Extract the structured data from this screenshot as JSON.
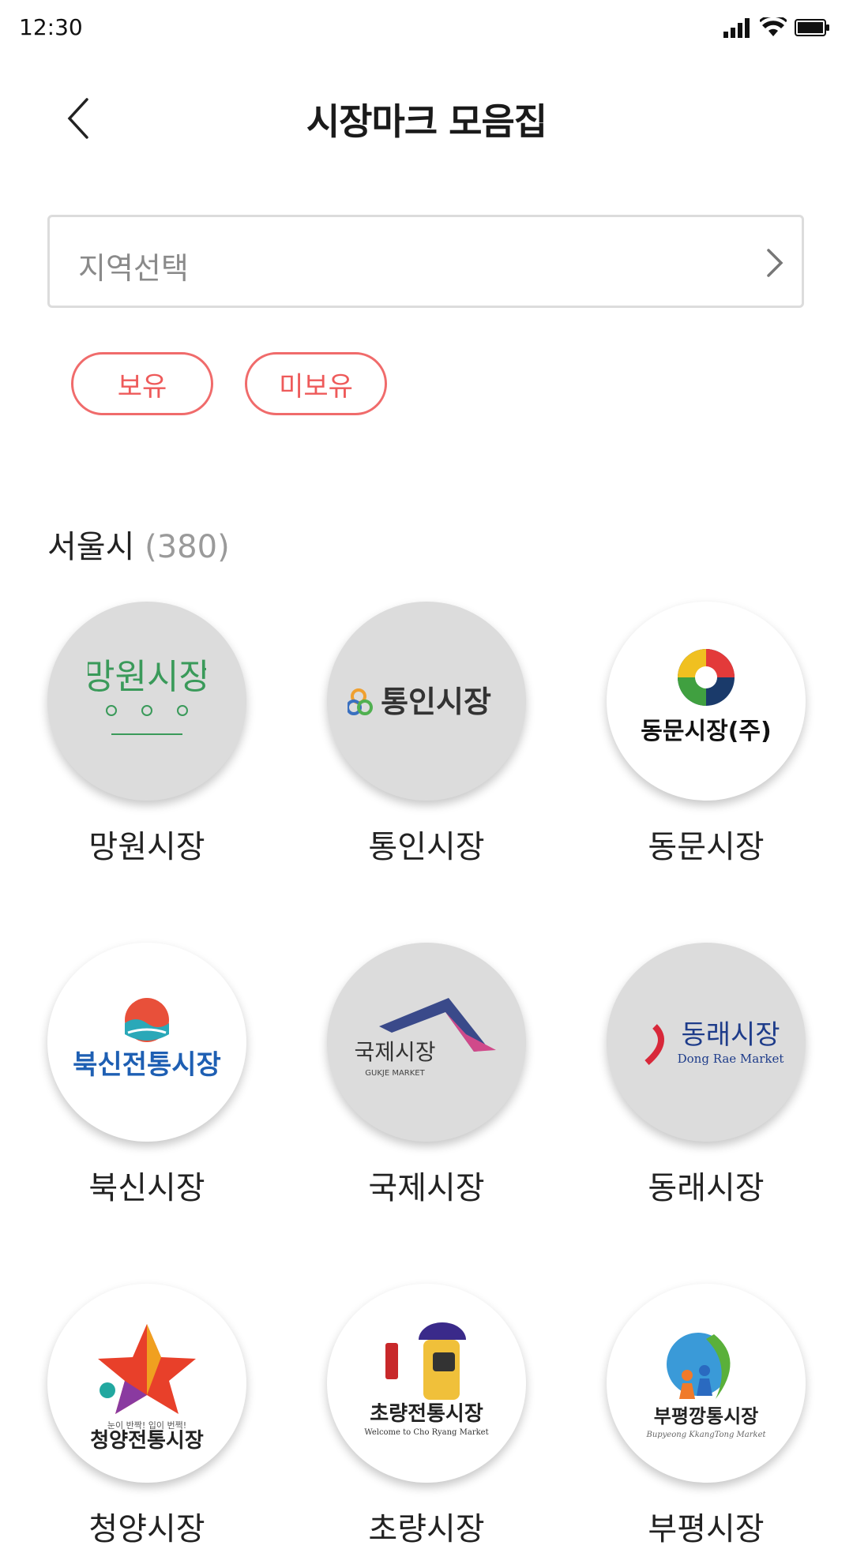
{
  "status_bar": {
    "time": "12:30"
  },
  "header": {
    "title": "시장마크 모음집"
  },
  "region_select": {
    "placeholder": "지역선택"
  },
  "filters": {
    "owned_label": "보유",
    "not_owned_label": "미보유"
  },
  "section": {
    "title": "서울시",
    "count": "(380)"
  },
  "markets": [
    {
      "name": "망원시장",
      "logo_text": "망원시장",
      "owned": false
    },
    {
      "name": "통인시장",
      "logo_text": "통인시장",
      "owned": false
    },
    {
      "name": "동문시장",
      "logo_text": "동문시장(주)",
      "owned": true
    },
    {
      "name": "북신시장",
      "logo_text": "북신전통시장",
      "owned": true
    },
    {
      "name": "국제시장",
      "logo_text": "국제시장",
      "logo_subtext": "GUKJE MARKET",
      "owned": false
    },
    {
      "name": "동래시장",
      "logo_text": "동래시장",
      "logo_subtext": "Dong Rae Market",
      "owned": false
    },
    {
      "name": "청양시장",
      "logo_text": "청양전통시장",
      "logo_subtext": "눈이 반짝! 입이 번쩍!",
      "owned": true
    },
    {
      "name": "초량시장",
      "logo_text": "초량전통시장",
      "logo_subtext": "Welcome to Cho Ryang Market",
      "owned": true
    },
    {
      "name": "부평시장",
      "logo_text": "부평깡통시장",
      "logo_subtext": "Bupyeong KkangTong Market",
      "owned": true
    }
  ],
  "colors": {
    "accent": "#ee5a5a",
    "gray_circle": "#dcdcdc",
    "green_logo": "#3a9a5a",
    "blue_logo": "#1e5fb3"
  }
}
